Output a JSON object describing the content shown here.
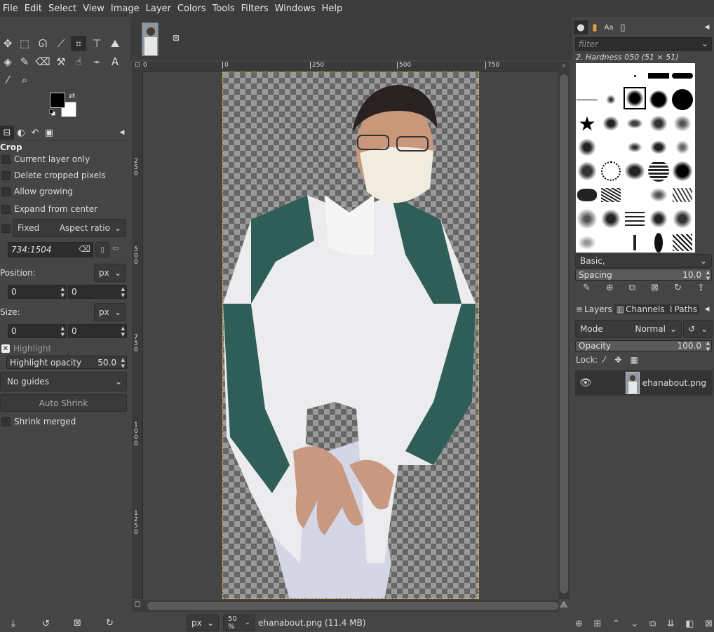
{
  "menu": [
    "File",
    "Edit",
    "Select",
    "View",
    "Image",
    "Layer",
    "Colors",
    "Tools",
    "Filters",
    "Windows",
    "Help"
  ],
  "tool_options": {
    "title": "Crop",
    "current_layer_only": "Current layer only",
    "delete_cropped_pixels": "Delete cropped pixels",
    "allow_growing": "Allow growing",
    "expand_from_center": "Expand from center",
    "fixed_label": "Fixed",
    "fixed_mode": "Aspect ratio",
    "ratio_value": "734:1504",
    "position_label": "Position:",
    "position_unit": "px",
    "position_x": "0",
    "position_y": "0",
    "size_label": "Size:",
    "size_unit": "px",
    "size_w": "0",
    "size_h": "0",
    "highlight": "Highlight",
    "highlight_opacity_label": "Highlight opacity",
    "highlight_opacity_value": "50.0",
    "guides": "No guides",
    "auto_shrink": "Auto Shrink",
    "shrink_merged": "Shrink merged"
  },
  "rulers": {
    "h_ticks": [
      "0",
      "250",
      "500",
      "750"
    ],
    "h_left_label": "0",
    "v_ticks": [
      "2\n5\n0",
      "5\n0\n0",
      "7\n5\n0",
      "1\n0\n0\n0",
      "1\n2\n5\n0"
    ]
  },
  "statusbar": {
    "unit": "px",
    "zoom": "50 %",
    "file_info": "ehanabout.png (11.4 MB)"
  },
  "brushes": {
    "filter_placeholder": "filter",
    "current": "2. Hardness 050 (51 × 51)",
    "tag": "Basic,",
    "spacing_label": "Spacing",
    "spacing_value": "10.0"
  },
  "layers_panel": {
    "tab_layers": "Layers",
    "tab_channels": "Channels",
    "tab_paths": "Paths",
    "mode_label": "Mode",
    "mode_value": "Normal",
    "opacity_label": "Opacity",
    "opacity_value": "100.0",
    "lock_label": "Lock:",
    "layer_name": "ehanabout.png"
  },
  "colors": {
    "fg": "#000000",
    "bg": "#ffffff",
    "accent_guide": "#d9c63a"
  }
}
